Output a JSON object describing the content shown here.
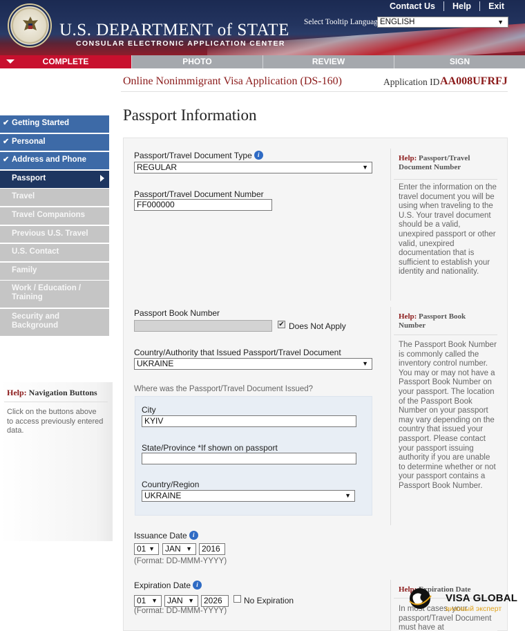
{
  "header": {
    "dept_title": "U.S. DEPARTMENT of STATE",
    "dept_subtitle": "CONSULAR ELECTRONIC APPLICATION CENTER",
    "links": [
      "Contact Us",
      "Help",
      "Exit"
    ],
    "tooltip_language_label": "Select Tooltip Language",
    "tooltip_language_value": "ENGLISH"
  },
  "steps": [
    "COMPLETE",
    "PHOTO",
    "REVIEW",
    "SIGN"
  ],
  "form": {
    "title": "Online Nonimmigrant Visa Application (DS-160)",
    "application_id_label": "Application ID",
    "application_id": "AA008UFRFJ",
    "page_heading": "Passport Information"
  },
  "sidebar": {
    "items": [
      {
        "label": "Getting Started",
        "state": "done"
      },
      {
        "label": "Personal",
        "state": "done"
      },
      {
        "label": "Address and Phone",
        "state": "done"
      },
      {
        "label": "Passport",
        "state": "current"
      },
      {
        "label": "Travel",
        "state": "todo"
      },
      {
        "label": "Travel Companions",
        "state": "todo"
      },
      {
        "label": "Previous U.S. Travel",
        "state": "todo"
      },
      {
        "label": "U.S. Contact",
        "state": "todo"
      },
      {
        "label": "Family",
        "state": "todo"
      },
      {
        "label": "Work / Education / Training",
        "state": "todo"
      },
      {
        "label": "Security and Background",
        "state": "todo"
      }
    ],
    "help_title_prefix": "Help:",
    "help_title": "Navigation Buttons",
    "help_text": "Click on the buttons above to access previously entered data."
  },
  "fields": {
    "doc_type_label": "Passport/Travel Document Type",
    "doc_type_value": "REGULAR",
    "doc_number_label": "Passport/Travel Document Number",
    "doc_number_value": "FF000000",
    "book_number_label": "Passport Book Number",
    "book_number_value": "",
    "does_not_apply_label": "Does Not Apply",
    "does_not_apply_checked": true,
    "issuing_country_label": "Country/Authority that Issued Passport/Travel Document",
    "issuing_country_value": "UKRAINE",
    "issued_where_label": "Where was the Passport/Travel Document Issued?",
    "city_label": "City",
    "city_value": "KYIV",
    "state_label": "State/Province *If shown on passport",
    "state_value": "",
    "country_label": "Country/Region",
    "country_value": "UKRAINE",
    "issuance_label": "Issuance Date",
    "issuance_day": "01",
    "issuance_month": "JAN",
    "issuance_year": "2016",
    "issuance_format": "(Format: DD-MMM-YYYY)",
    "expiration_label": "Expiration Date",
    "expiration_day": "01",
    "expiration_month": "JAN",
    "expiration_year": "2026",
    "no_expiration_label": "No Expiration",
    "no_expiration_checked": false,
    "expiration_format": "(Format: DD-MMM-YYYY)"
  },
  "help": {
    "prefix": "Help:",
    "doc_number_title": "Passport/Travel Document Number",
    "doc_number_text": "Enter the information on the travel document you will be using when traveling to the U.S. Your travel document should be a valid, unexpired passport or other valid, unexpired documentation that is sufficient to establish your identity and nationality.",
    "book_number_title": "Passport Book Number",
    "book_number_text": "The Passport Book Number is commonly called the inventory control number. You may or may not have a Passport Book Number on your passport. The location of the Passport Book Number on your passport may vary depending on the country that issued your passport. Please contact your passport issuing authority if you are unable to determine whether or not your passport contains a Passport Book Number.",
    "expiration_title": "Expiration Date",
    "expiration_text": "In most cases, your passport/Travel Document must have at"
  },
  "watermark": {
    "name": "VISA GLOBAL",
    "tagline": "визовый эксперт"
  },
  "colors": {
    "active_step": "#c8102e",
    "nav_done": "#3d6aa7",
    "nav_current": "#1e3660",
    "nav_todo": "#c5c5c5",
    "title_red": "#8b1a1a"
  }
}
